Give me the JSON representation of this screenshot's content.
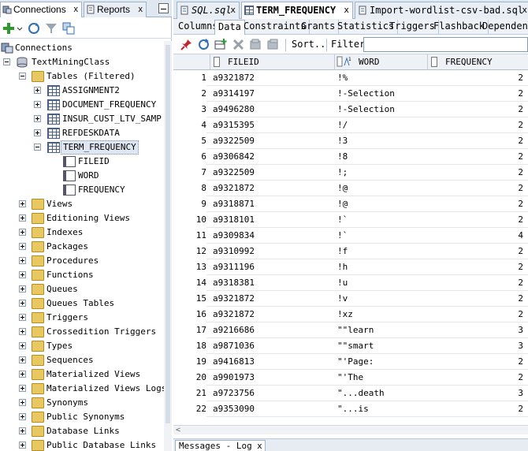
{
  "left_panel": {
    "tabs": [
      {
        "label": "Connections",
        "close": "x"
      },
      {
        "label": "Reports",
        "close": "x"
      }
    ],
    "tree": [
      {
        "label": "Connections",
        "icon": "connections-icon"
      },
      {
        "label": "TextMiningClass",
        "icon": "database-icon"
      },
      {
        "label": "Tables (Filtered)",
        "icon": "folder-icon"
      },
      {
        "label": "ASSIGNMENT2",
        "icon": "table-icon"
      },
      {
        "label": "DOCUMENT_FREQUENCY",
        "icon": "table-icon"
      },
      {
        "label": "INSUR_CUST_LTV_SAMPLE",
        "icon": "table-icon"
      },
      {
        "label": "REFDESKDATA",
        "icon": "table-icon"
      },
      {
        "label": "TERM_FREQUENCY",
        "icon": "table-icon"
      },
      {
        "label": "FILEID",
        "icon": "column-icon"
      },
      {
        "label": "WORD",
        "icon": "column-icon"
      },
      {
        "label": "FREQUENCY",
        "icon": "column-icon"
      },
      {
        "label": "Views",
        "icon": "folder-icon"
      },
      {
        "label": "Editioning Views",
        "icon": "folder-icon"
      },
      {
        "label": "Indexes",
        "icon": "folder-icon"
      },
      {
        "label": "Packages",
        "icon": "folder-icon"
      },
      {
        "label": "Procedures",
        "icon": "folder-icon"
      },
      {
        "label": "Functions",
        "icon": "folder-icon"
      },
      {
        "label": "Queues",
        "icon": "folder-icon"
      },
      {
        "label": "Queues Tables",
        "icon": "folder-icon"
      },
      {
        "label": "Triggers",
        "icon": "folder-icon"
      },
      {
        "label": "Crossedition Triggers",
        "icon": "folder-icon"
      },
      {
        "label": "Types",
        "icon": "folder-icon"
      },
      {
        "label": "Sequences",
        "icon": "folder-icon"
      },
      {
        "label": "Materialized Views",
        "icon": "folder-icon"
      },
      {
        "label": "Materialized Views Logs",
        "icon": "folder-icon"
      },
      {
        "label": "Synonyms",
        "icon": "folder-icon"
      },
      {
        "label": "Public Synonyms",
        "icon": "folder-icon"
      },
      {
        "label": "Database Links",
        "icon": "folder-icon"
      },
      {
        "label": "Public Database Links",
        "icon": "folder-icon"
      }
    ]
  },
  "editor": {
    "tabs": [
      {
        "label": "SQL.sql",
        "close": "x"
      },
      {
        "label": "TERM_FREQUENCY",
        "close": "x"
      },
      {
        "label": "Import-wordlist-csv-bad.sql",
        "close": "x"
      }
    ],
    "subtabs": [
      "Columns",
      "Data",
      "Constraints",
      "Grants",
      "Statistics",
      "Triggers",
      "Flashback",
      "Dependencies"
    ],
    "active_subtab": "Data",
    "toolbar": {
      "sort_label": "Sort..",
      "filter_label": "Filter:",
      "filter_value": ""
    },
    "grid": {
      "columns": [
        "FILEID",
        "WORD",
        "FREQUENCY"
      ],
      "rows": [
        {
          "n": "1",
          "fileid": "a9321872",
          "word": "!%",
          "freq": "2"
        },
        {
          "n": "2",
          "fileid": "a9314197",
          "word": "!-Selection",
          "freq": "2"
        },
        {
          "n": "3",
          "fileid": "a9496280",
          "word": "!-Selection",
          "freq": "2"
        },
        {
          "n": "4",
          "fileid": "a9315395",
          "word": "!/",
          "freq": "2"
        },
        {
          "n": "5",
          "fileid": "a9322509",
          "word": "!3",
          "freq": "2"
        },
        {
          "n": "6",
          "fileid": "a9306842",
          "word": "!8",
          "freq": "2"
        },
        {
          "n": "7",
          "fileid": "a9322509",
          "word": "!;",
          "freq": "2"
        },
        {
          "n": "8",
          "fileid": "a9321872",
          "word": "!@",
          "freq": "2"
        },
        {
          "n": "9",
          "fileid": "a9318871",
          "word": "!@",
          "freq": "2"
        },
        {
          "n": "10",
          "fileid": "a9318101",
          "word": "!`",
          "freq": "2"
        },
        {
          "n": "11",
          "fileid": "a9309834",
          "word": "!`",
          "freq": "4"
        },
        {
          "n": "12",
          "fileid": "a9310992",
          "word": "!f",
          "freq": "2"
        },
        {
          "n": "13",
          "fileid": "a9311196",
          "word": "!h",
          "freq": "2"
        },
        {
          "n": "14",
          "fileid": "a9318381",
          "word": "!u",
          "freq": "2"
        },
        {
          "n": "15",
          "fileid": "a9321872",
          "word": "!v",
          "freq": "2"
        },
        {
          "n": "16",
          "fileid": "a9321872",
          "word": "!xz",
          "freq": "2"
        },
        {
          "n": "17",
          "fileid": "a9216686",
          "word": "\"\"learn",
          "freq": "3"
        },
        {
          "n": "18",
          "fileid": "a9871036",
          "word": "\"\"smart",
          "freq": "3"
        },
        {
          "n": "19",
          "fileid": "a9416813",
          "word": "\"'Page:",
          "freq": "2"
        },
        {
          "n": "20",
          "fileid": "a9901973",
          "word": "\"'The",
          "freq": "2"
        },
        {
          "n": "21",
          "fileid": "a9723756",
          "word": "\"...death",
          "freq": "3"
        },
        {
          "n": "22",
          "fileid": "a9353090",
          "word": "\"...is",
          "freq": "2"
        }
      ]
    },
    "bottom_tab": {
      "label": "Messages - Log",
      "close": "x"
    }
  },
  "colors": {
    "selection": "#dde6f1",
    "tab_bar": "#dfe7f1",
    "border": "#9fb3cc",
    "folder": "#e8c860"
  }
}
